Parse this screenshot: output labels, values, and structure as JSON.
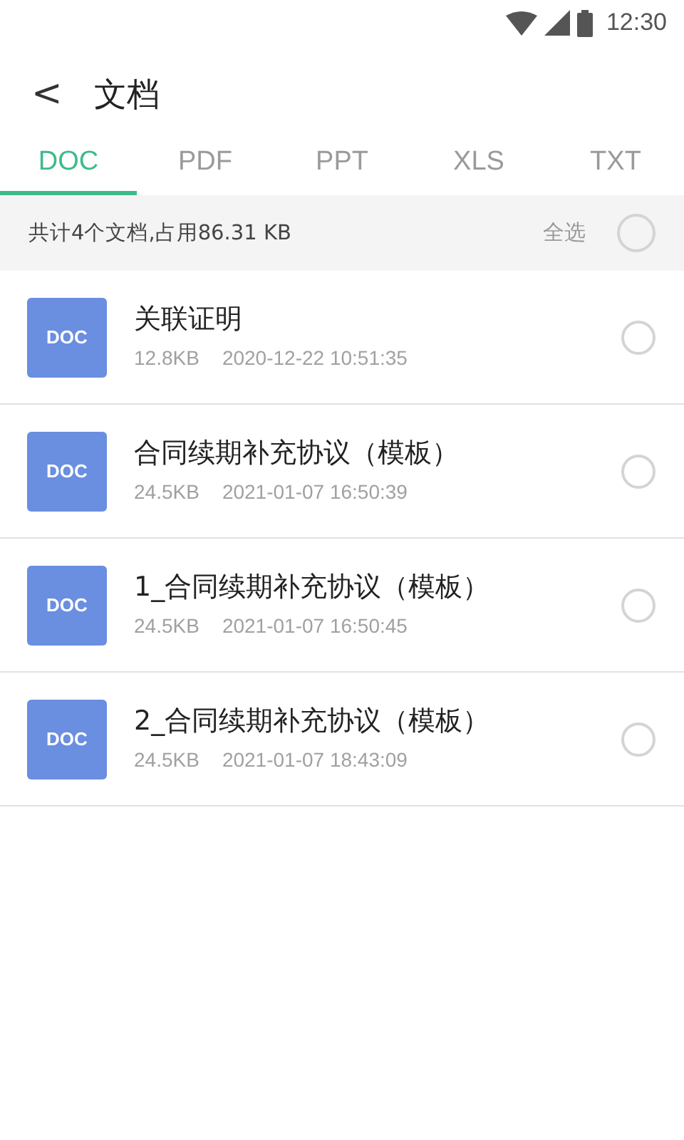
{
  "status_bar": {
    "time": "12:30"
  },
  "header": {
    "back": "<",
    "title": "文档"
  },
  "tabs": [
    {
      "label": "DOC",
      "selected": true
    },
    {
      "label": "PDF",
      "selected": false
    },
    {
      "label": "PPT",
      "selected": false
    },
    {
      "label": "XLS",
      "selected": false
    },
    {
      "label": "TXT",
      "selected": false
    }
  ],
  "summary": {
    "text": "共计4个文档,占用86.31 KB",
    "select_all": "全选",
    "checked": false
  },
  "files": [
    {
      "type": "DOC",
      "name": "关联证明",
      "size": "12.8KB",
      "date": "2020-12-22 10:51:35",
      "checked": false
    },
    {
      "type": "DOC",
      "name": "合同续期补充协议（模板）",
      "size": "24.5KB",
      "date": "2021-01-07 16:50:39",
      "checked": false
    },
    {
      "type": "DOC",
      "name": "1_合同续期补充协议（模板）",
      "size": "24.5KB",
      "date": "2021-01-07 16:50:45",
      "checked": false
    },
    {
      "type": "DOC",
      "name": "2_合同续期补充协议（模板）",
      "size": "24.5KB",
      "date": "2021-01-07 18:43:09",
      "checked": false
    }
  ]
}
